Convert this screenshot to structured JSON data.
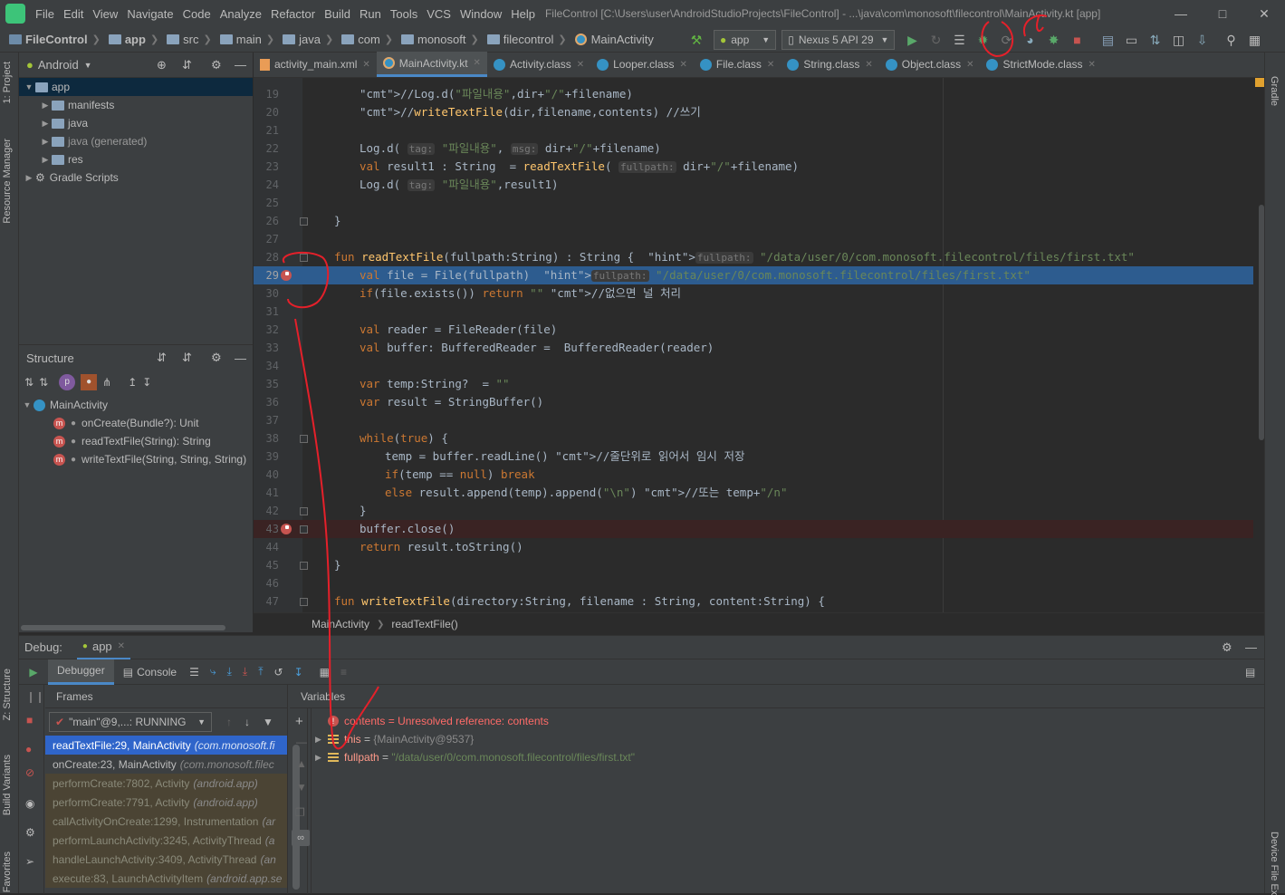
{
  "menu": [
    "File",
    "Edit",
    "View",
    "Navigate",
    "Code",
    "Analyze",
    "Refactor",
    "Build",
    "Run",
    "Tools",
    "VCS",
    "Window",
    "Help"
  ],
  "window_title": "FileControl [C:\\Users\\user\\AndroidStudioProjects\\FileControl] - ...\\java\\com\\monosoft\\filecontrol\\MainActivity.kt [app]",
  "breadcrumbs": [
    "FileControl",
    "app",
    "src",
    "main",
    "java",
    "com",
    "monosoft",
    "filecontrol",
    "MainActivity"
  ],
  "toolbar": {
    "run_config": "app",
    "device": "Nexus 5 API 29"
  },
  "project_panel": {
    "view": "Android",
    "items": [
      {
        "label": "app",
        "depth": 0,
        "open": true
      },
      {
        "label": "manifests",
        "depth": 1
      },
      {
        "label": "java",
        "depth": 1
      },
      {
        "label": "java (generated)",
        "depth": 1
      },
      {
        "label": "res",
        "depth": 1
      },
      {
        "label": "Gradle Scripts",
        "depth": 0
      }
    ]
  },
  "structure_panel": {
    "title": "Structure",
    "root": "MainActivity",
    "members": [
      "onCreate(Bundle?): Unit",
      "readTextFile(String): String",
      "writeTextFile(String, String, String)"
    ]
  },
  "editor_tabs": [
    {
      "label": "activity_main.xml",
      "kind": "xml"
    },
    {
      "label": "MainActivity.kt",
      "kind": "kt",
      "active": true
    },
    {
      "label": "Activity.class",
      "kind": "class"
    },
    {
      "label": "Looper.class",
      "kind": "class"
    },
    {
      "label": "File.class",
      "kind": "class"
    },
    {
      "label": "String.class",
      "kind": "class"
    },
    {
      "label": "Object.class",
      "kind": "class"
    },
    {
      "label": "StrictMode.class",
      "kind": "class"
    }
  ],
  "code_lines": [
    {
      "n": "19",
      "t": "//Log.d(\"파일내용\",dir+\"/\"+filename)"
    },
    {
      "n": "20",
      "t": "//writeTextFile(dir,filename,contents) //쓰기"
    },
    {
      "n": "21",
      "t": ""
    },
    {
      "n": "22",
      "t": "Log.d( tag: \"파일내용\", msg: dir+\"/\"+filename)"
    },
    {
      "n": "23",
      "t": "val result1 : String  = readTextFile( fullpath: dir+\"/\"+filename)"
    },
    {
      "n": "24",
      "t": "Log.d( tag: \"파일내용\",result1)"
    },
    {
      "n": "25",
      "t": ""
    },
    {
      "n": "26",
      "t": "}"
    },
    {
      "n": "27",
      "t": ""
    },
    {
      "n": "28",
      "t": "fun readTextFile(fullpath:String) : String {  fullpath: \"/data/user/0/com.monosoft.filecontrol/files/first.txt\""
    },
    {
      "n": "29",
      "t": "val file = File(fullpath)  fullpath: \"/data/user/0/com.monosoft.filecontrol/files/first.txt\""
    },
    {
      "n": "30",
      "t": "if(file.exists()) return \"\" //없으면 널 처리"
    },
    {
      "n": "31",
      "t": ""
    },
    {
      "n": "32",
      "t": "val reader = FileReader(file)"
    },
    {
      "n": "33",
      "t": "val buffer: BufferedReader =  BufferedReader(reader)"
    },
    {
      "n": "34",
      "t": ""
    },
    {
      "n": "35",
      "t": "var temp:String?  = \"\""
    },
    {
      "n": "36",
      "t": "var result = StringBuffer()"
    },
    {
      "n": "37",
      "t": ""
    },
    {
      "n": "38",
      "t": "while(true) {"
    },
    {
      "n": "39",
      "t": "temp = buffer.readLine() //줄단위로 읽어서 임시 저장"
    },
    {
      "n": "40",
      "t": "if(temp == null) break"
    },
    {
      "n": "41",
      "t": "else result.append(temp).append(\"\\n\") //또는 temp+\"/n\""
    },
    {
      "n": "42",
      "t": "}"
    },
    {
      "n": "43",
      "t": "buffer.close()"
    },
    {
      "n": "44",
      "t": "return result.toString()"
    },
    {
      "n": "45",
      "t": "}"
    },
    {
      "n": "46",
      "t": ""
    },
    {
      "n": "47",
      "t": "fun writeTextFile(directory:String, filename : String, content:String) {"
    }
  ],
  "editor_breadcrumb": [
    "MainActivity",
    "readTextFile()"
  ],
  "debug": {
    "title": "Debug:",
    "session": "app",
    "tabs": [
      "Debugger",
      "Console"
    ],
    "frames_label": "Frames",
    "variables_label": "Variables",
    "thread": "\"main\"@9,...: RUNNING",
    "frames": [
      {
        "m": "readTextFile:29, MainActivity",
        "p": "(com.monosoft.fi",
        "kind": "sel"
      },
      {
        "m": "onCreate:23, MainActivity",
        "p": "(com.monosoft.filec",
        "kind": "app"
      },
      {
        "m": "performCreate:7802, Activity",
        "p": "(android.app)",
        "kind": "lib"
      },
      {
        "m": "performCreate:7791, Activity",
        "p": "(android.app)",
        "kind": "lib"
      },
      {
        "m": "callActivityOnCreate:1299, Instrumentation",
        "p": "(ar",
        "kind": "lib"
      },
      {
        "m": "performLaunchActivity:3245, ActivityThread",
        "p": "(a",
        "kind": "lib"
      },
      {
        "m": "handleLaunchActivity:3409, ActivityThread",
        "p": "(an",
        "kind": "lib"
      },
      {
        "m": "execute:83, LaunchActivityItem",
        "p": "(android.app.se",
        "kind": "lib"
      }
    ],
    "variables": [
      {
        "name": "contents",
        "eq": " = ",
        "val": "Unresolved reference: contents",
        "kind": "error"
      },
      {
        "name": "this",
        "eq": " = ",
        "val": "{MainActivity@9537}",
        "kind": "obj"
      },
      {
        "name": "fullpath",
        "eq": " = ",
        "val": "\"/data/user/0/com.monosoft.filecontrol/files/first.txt\"",
        "kind": "str"
      }
    ]
  },
  "side_tabs": {
    "left": [
      "1: Project",
      "Resource Manager",
      "Z: Structure",
      "Build Variants",
      "Favorites"
    ],
    "right": [
      "Gradle",
      "Device File Ex"
    ]
  }
}
